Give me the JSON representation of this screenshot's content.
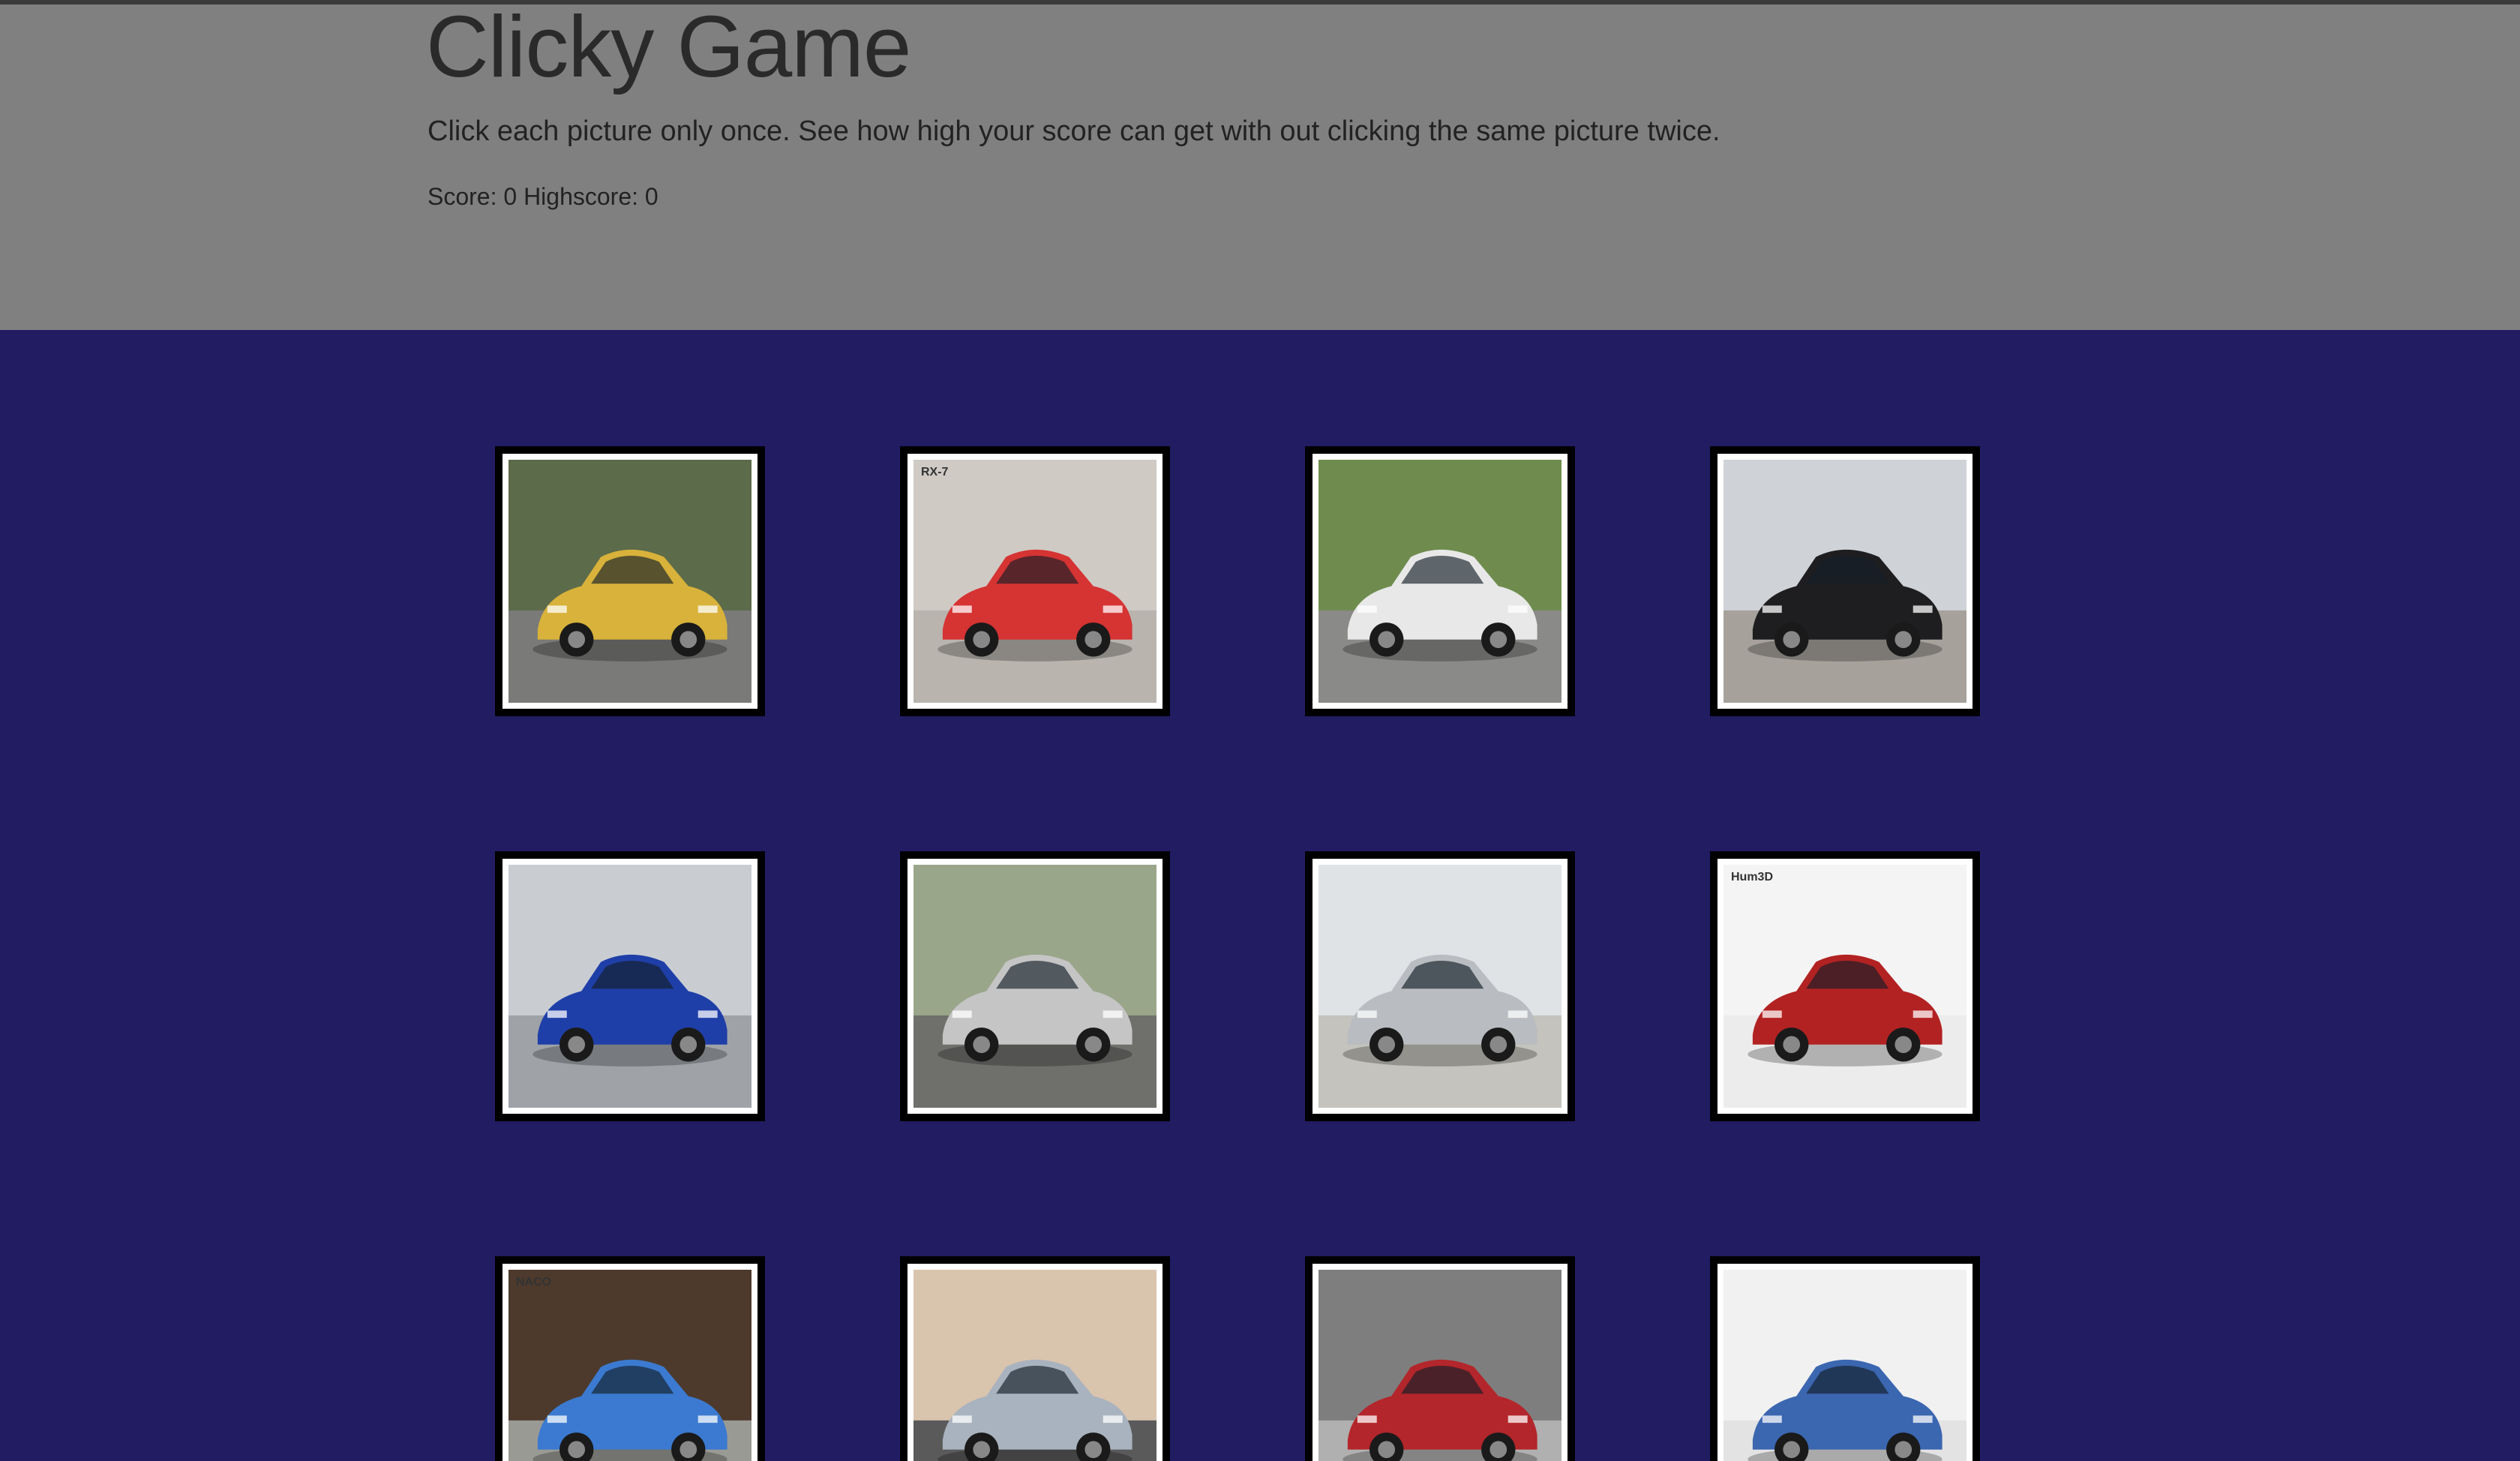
{
  "header": {
    "title": "Clicky Game",
    "lead": "Click each picture only once. See how high your score can get with out clicking the same picture twice.",
    "score_label": "Score:",
    "score": "0",
    "highscore_label": "Highscore:",
    "highscore": "0"
  },
  "cards": [
    {
      "name": "card-yellow-suv",
      "bg": "#5c6b4a",
      "ground": "#7a7a78",
      "car": "#d8b23a",
      "text": ""
    },
    {
      "name": "card-red-sports-car",
      "bg": "#cfcac4",
      "ground": "#b9b4ae",
      "car": "#d63333",
      "text": "RX-7"
    },
    {
      "name": "card-white-sedan",
      "bg": "#6f8c4e",
      "ground": "#8a8a88",
      "car": "#e8e8e8",
      "text": ""
    },
    {
      "name": "card-black-sedan",
      "bg": "#cfd2d6",
      "ground": "#a6a29b",
      "car": "#1e1e20",
      "text": ""
    },
    {
      "name": "card-blue-sports-car",
      "bg": "#c9cdd2",
      "ground": "#9fa3a8",
      "car": "#1f3fa8",
      "text": ""
    },
    {
      "name": "card-silver-coupe",
      "bg": "#9aa68a",
      "ground": "#6f6f6c",
      "car": "#c5c5c5",
      "text": ""
    },
    {
      "name": "card-silver-gtr",
      "bg": "#dfe3e6",
      "ground": "#c4c3bd",
      "car": "#b9bcc0",
      "text": ""
    },
    {
      "name": "card-red-mustang",
      "bg": "#f4f4f4",
      "ground": "#ececec",
      "car": "#b32222",
      "text": "Hum3D"
    },
    {
      "name": "card-blue-bmw",
      "bg": "#4d3a2c",
      "ground": "#9a9a95",
      "car": "#3b7ad0",
      "text": "NACO"
    },
    {
      "name": "card-silver-jaguar",
      "bg": "#d9c4ae",
      "ground": "#5a5a5a",
      "car": "#a9b3bf",
      "text": ""
    },
    {
      "name": "card-red-classic-bmw",
      "bg": "#7e7e7e",
      "ground": "#b0b0b0",
      "car": "#b3262b",
      "text": ""
    },
    {
      "name": "card-blue-hatchback",
      "bg": "#f1f1f1",
      "ground": "#e3e3e3",
      "car": "#3b66b0",
      "text": ""
    }
  ]
}
